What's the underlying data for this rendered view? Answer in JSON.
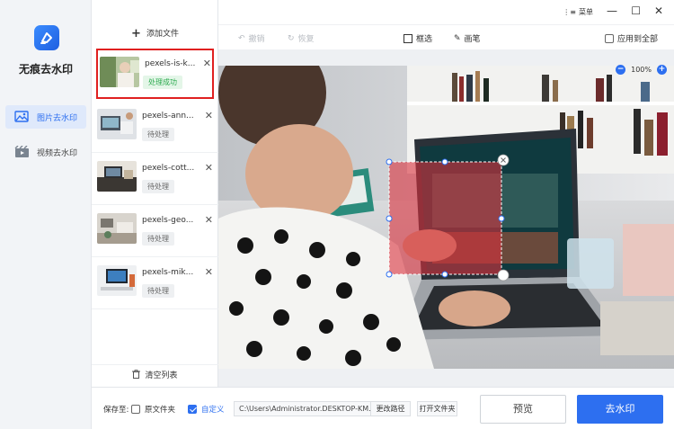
{
  "app": {
    "name": "无痕去水印"
  },
  "nav": {
    "items": [
      {
        "label": "图片去水印",
        "active": true
      },
      {
        "label": "视频去水印",
        "active": false
      }
    ]
  },
  "files": {
    "add_label": "添加文件",
    "items": [
      {
        "name": "pexels-is-k...",
        "status": "处理成功",
        "status_type": "success",
        "selected": true
      },
      {
        "name": "pexels-ann...",
        "status": "待处理",
        "status_type": "pending",
        "selected": false
      },
      {
        "name": "pexels-cott...",
        "status": "待处理",
        "status_type": "pending",
        "selected": false
      },
      {
        "name": "pexels-geo...",
        "status": "待处理",
        "status_type": "pending",
        "selected": false
      },
      {
        "name": "pexels-mik...",
        "status": "待处理",
        "status_type": "pending",
        "selected": false
      }
    ],
    "clear_label": "清空列表"
  },
  "titlebar": {
    "menu_label": "菜单"
  },
  "toolbar": {
    "undo_label": "撤销",
    "redo_label": "恢复",
    "box_select_label": "框选",
    "brush_label": "画笔",
    "apply_all_label": "应用到全部",
    "apply_all_checked": false
  },
  "canvas": {
    "zoom": "100%"
  },
  "bottom": {
    "save_to_label": "保存至:",
    "original_folder_label": "原文件夹",
    "original_folder_checked": false,
    "custom_label": "自定义",
    "custom_checked": true,
    "path_value": "C:\\Users\\Administrator.DESKTOP-KM...",
    "change_path_label": "更改路径",
    "open_folder_label": "打开文件夹",
    "preview_label": "预览",
    "remove_watermark_label": "去水印"
  },
  "colors": {
    "accent": "#2d6ff0",
    "selection_border": "#e02020",
    "success": "#2dab4f",
    "mask": "#d9303c"
  }
}
